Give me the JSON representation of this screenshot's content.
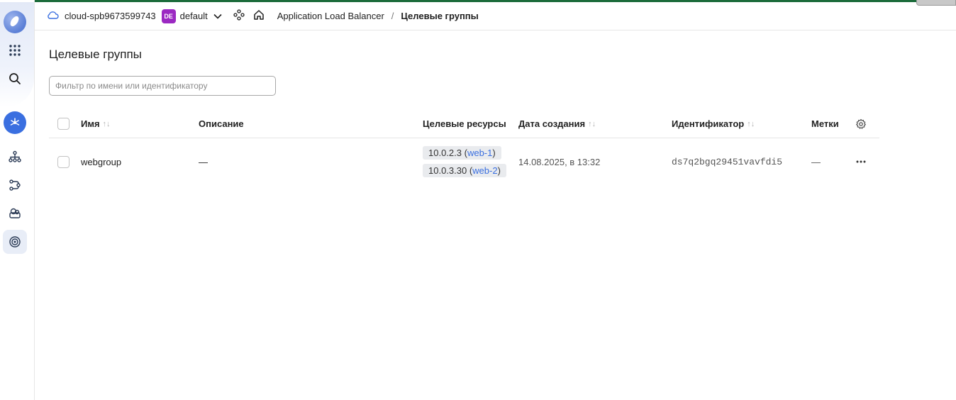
{
  "header": {
    "cloud_name": "cloud-spb9673599743",
    "folder_badge": "DE",
    "folder_name": "default",
    "breadcrumb_service": "Application Load Balancer",
    "breadcrumb_separator": "/",
    "breadcrumb_current": "Целевые группы"
  },
  "page": {
    "title": "Целевые группы",
    "filter_placeholder": "Фильтр по имени или идентификатору",
    "filter_value": ""
  },
  "table": {
    "columns": {
      "name": "Имя",
      "description": "Описание",
      "targets": "Целевые ресурсы",
      "created": "Дата создания",
      "id": "Идентификатор",
      "labels": "Метки"
    },
    "rows": [
      {
        "name": "webgroup",
        "description": "—",
        "targets": [
          {
            "ip": "10.0.2.3",
            "open": " (",
            "host": "web-1",
            "close": ")"
          },
          {
            "ip": "10.0.3.30",
            "open": " (",
            "host": "web-2",
            "close": ")"
          }
        ],
        "created": "14.08.2025, в 13:32",
        "id": "ds7q2bgq29451vavfdi5",
        "labels": "—"
      }
    ]
  },
  "icons": {
    "sidebar": [
      "logo",
      "apps-grid-icon",
      "search-icon",
      "load-balancer-icon",
      "network-tree-icon",
      "routing-icon",
      "backend-icon",
      "target-icon"
    ],
    "header": [
      "cloud-icon",
      "chevron-down-icon",
      "nodes-icon",
      "home-icon"
    ]
  },
  "colors": {
    "accent": "#3a6fe0",
    "folder_badge": "#9b29c2",
    "top_line": "#1b6b3a"
  }
}
